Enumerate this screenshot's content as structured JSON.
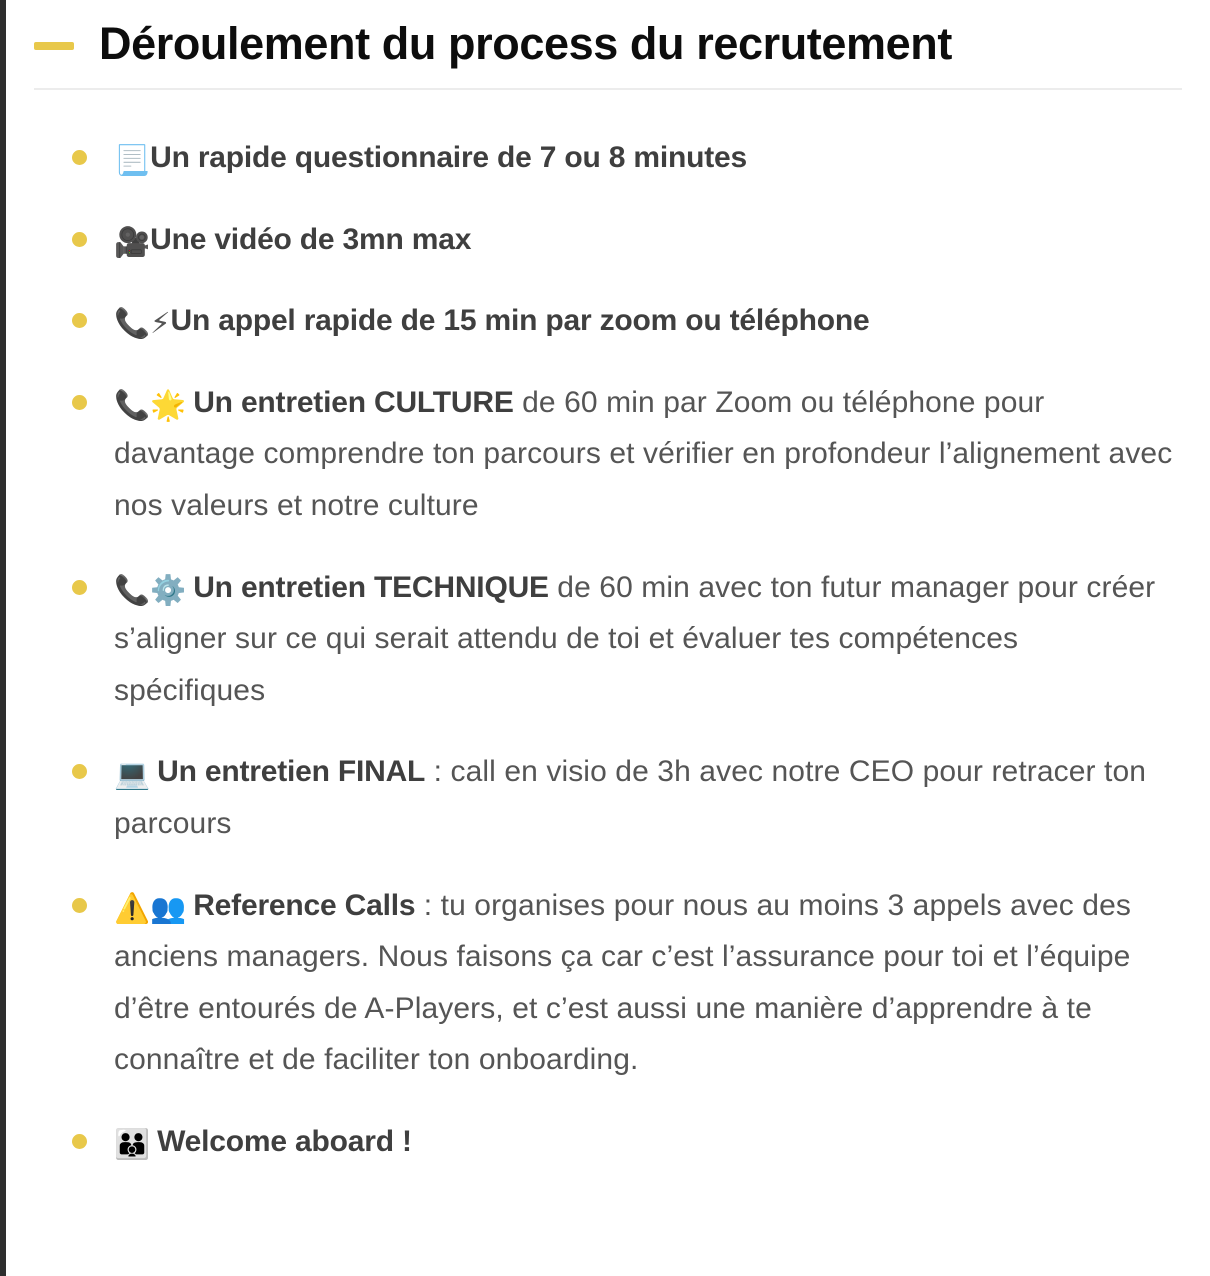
{
  "page": {
    "background_color": "#ffffff",
    "edge_strip_color": "#2e2e2e",
    "accent_color": "#e8c84a",
    "text_color": "#555555",
    "bold_text_color": "#3f3f3f",
    "divider_color": "#ececec"
  },
  "header": {
    "title": "Déroulement du process du recrutement",
    "dash_marker": "yellow-dash"
  },
  "steps": [
    {
      "id": "questionnaire",
      "emoji": "📃",
      "emoji_name": "page-with-curl-icon",
      "bold": "Un rapide questionnaire de 7 ou 8 minutes",
      "regular": ""
    },
    {
      "id": "video",
      "emoji": "🎥",
      "emoji_name": "movie-camera-icon",
      "bold": "Une vidéo de 3mn max",
      "regular": ""
    },
    {
      "id": "quick-call",
      "emoji": "📞⚡",
      "emoji_name": "telephone-receiver-icon high-voltage-icon",
      "bold": "Un appel rapide de 15 min par zoom ou téléphone",
      "regular": ""
    },
    {
      "id": "culture-interview",
      "emoji": "📞🌟",
      "emoji_name": "telephone-receiver-icon glowing-star-icon",
      "bold": "Un entretien CULTURE",
      "regular": " de 60 min par Zoom ou téléphone pour davantage comprendre ton parcours et vérifier en profondeur l’alignement avec nos valeurs et notre culture"
    },
    {
      "id": "technical-interview",
      "emoji": "📞⚙️",
      "emoji_name": "telephone-receiver-icon gear-icon",
      "bold": "Un entretien TECHNIQUE",
      "regular": " de 60 min avec ton futur manager pour créer s’aligner sur ce qui serait attendu de toi et évaluer tes compétences spécifiques"
    },
    {
      "id": "final-interview",
      "emoji": "💻",
      "emoji_name": "laptop-icon",
      "bold": "Un entretien FINAL",
      "regular": " : call en visio de 3h avec notre CEO pour retracer ton parcours"
    },
    {
      "id": "reference-calls",
      "emoji": "⚠️👥",
      "emoji_name": "warning-icon busts-in-silhouette-icon",
      "bold": "Reference Calls",
      "regular": " : tu organises pour nous au moins 3 appels avec des anciens managers. Nous faisons ça car c’est l’assurance pour toi et l’équipe d’être entourés de A-Players, et c’est aussi une manière d’apprendre à te connaître et de faciliter ton onboarding."
    },
    {
      "id": "welcome",
      "emoji": "👨‍👨‍👦",
      "emoji_name": "family-icon",
      "bold": "Welcome aboard !",
      "regular": ""
    }
  ]
}
